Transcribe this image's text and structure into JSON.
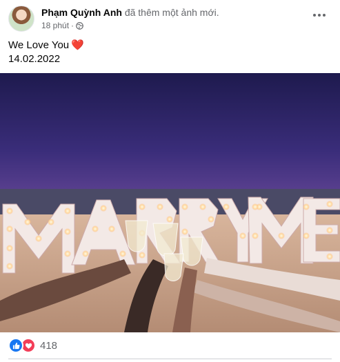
{
  "post": {
    "author": "Phạm Quỳnh Anh",
    "action": "đã thêm một ảnh mới.",
    "time": "18 phút",
    "separator": "·",
    "privacy_icon": "globe-icon",
    "caption_line1": "We Love You",
    "caption_emoji": "❤️",
    "caption_line2": "14.02.2022",
    "photo_sign_text": "MARRY ME",
    "reactions": {
      "icons": [
        "like-icon",
        "love-icon"
      ],
      "count": "418"
    }
  },
  "colors": {
    "like": "#1877f2",
    "love": "#f33e58",
    "secondary_text": "#65676b"
  }
}
